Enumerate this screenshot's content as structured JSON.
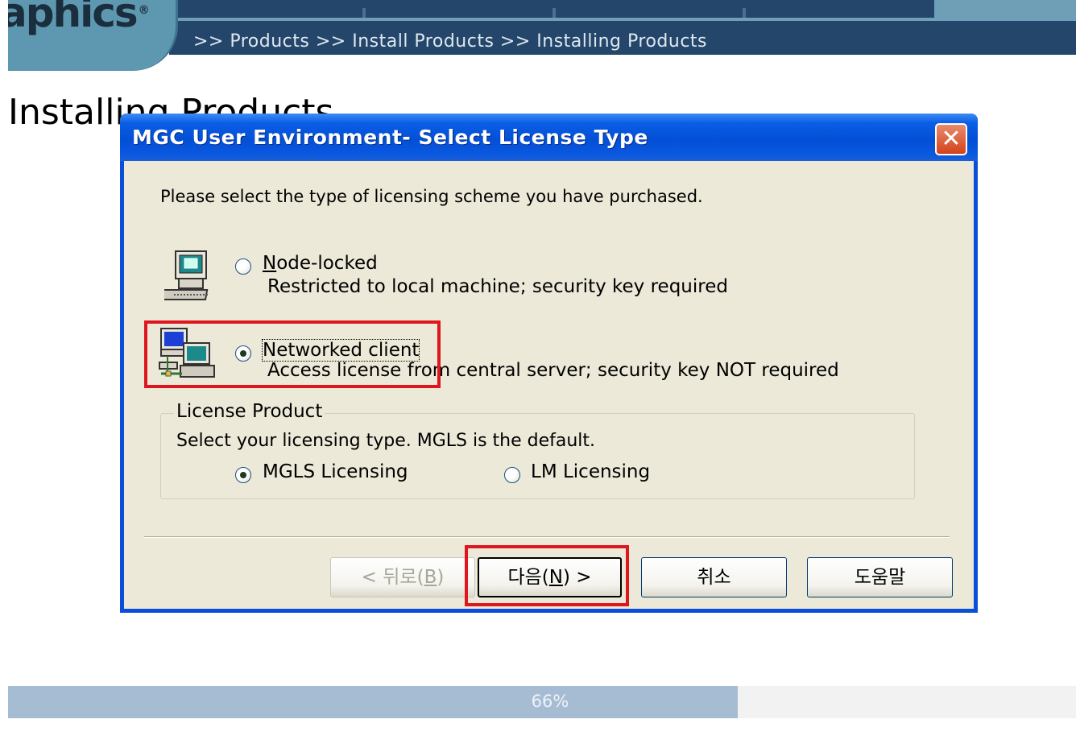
{
  "header": {
    "logo_text": "aphics",
    "logo_reg_mark": "®",
    "breadcrumb": ">> Products >> Install Products >> Installing Products"
  },
  "page": {
    "heading": "Installing Products"
  },
  "dialog": {
    "title": "MGC User Environment- Select License Type",
    "close_glyph": "✕",
    "prompt": "Please select the type of licensing scheme you have purchased.",
    "options": [
      {
        "label_mnemonic": "N",
        "label_rest": "ode-locked",
        "description": "Restricted to local machine; security key required",
        "selected": false,
        "icon": "standalone-computer-icon"
      },
      {
        "label": "Networked client",
        "description": "Access license from central server; security key NOT required",
        "selected": true,
        "icon": "networked-computers-icon"
      }
    ],
    "license_product": {
      "legend": "License Product",
      "text": "Select your licensing type. MGLS is the default.",
      "options": [
        {
          "label": "MGLS Licensing",
          "selected": true
        },
        {
          "label": "LM Licensing",
          "selected": false
        }
      ]
    },
    "buttons": {
      "back": {
        "prefix": "< 뒤로(",
        "mnemonic": "B",
        "suffix": ")",
        "enabled": false
      },
      "next": {
        "prefix": "다음(",
        "mnemonic": "N",
        "suffix": ") >",
        "enabled": true
      },
      "cancel": {
        "label": "취소"
      },
      "help": {
        "label": "도움말"
      }
    }
  },
  "progress": {
    "value": 0.66,
    "label": "66%"
  },
  "colors": {
    "header_dark": "#23466a",
    "logo_teal": "#5e98b0",
    "dialog_frame": "#0a4fd8",
    "dialog_face": "#ece9d8",
    "progress_fill": "#a6bcd3",
    "annotation_red": "#e0161f"
  }
}
